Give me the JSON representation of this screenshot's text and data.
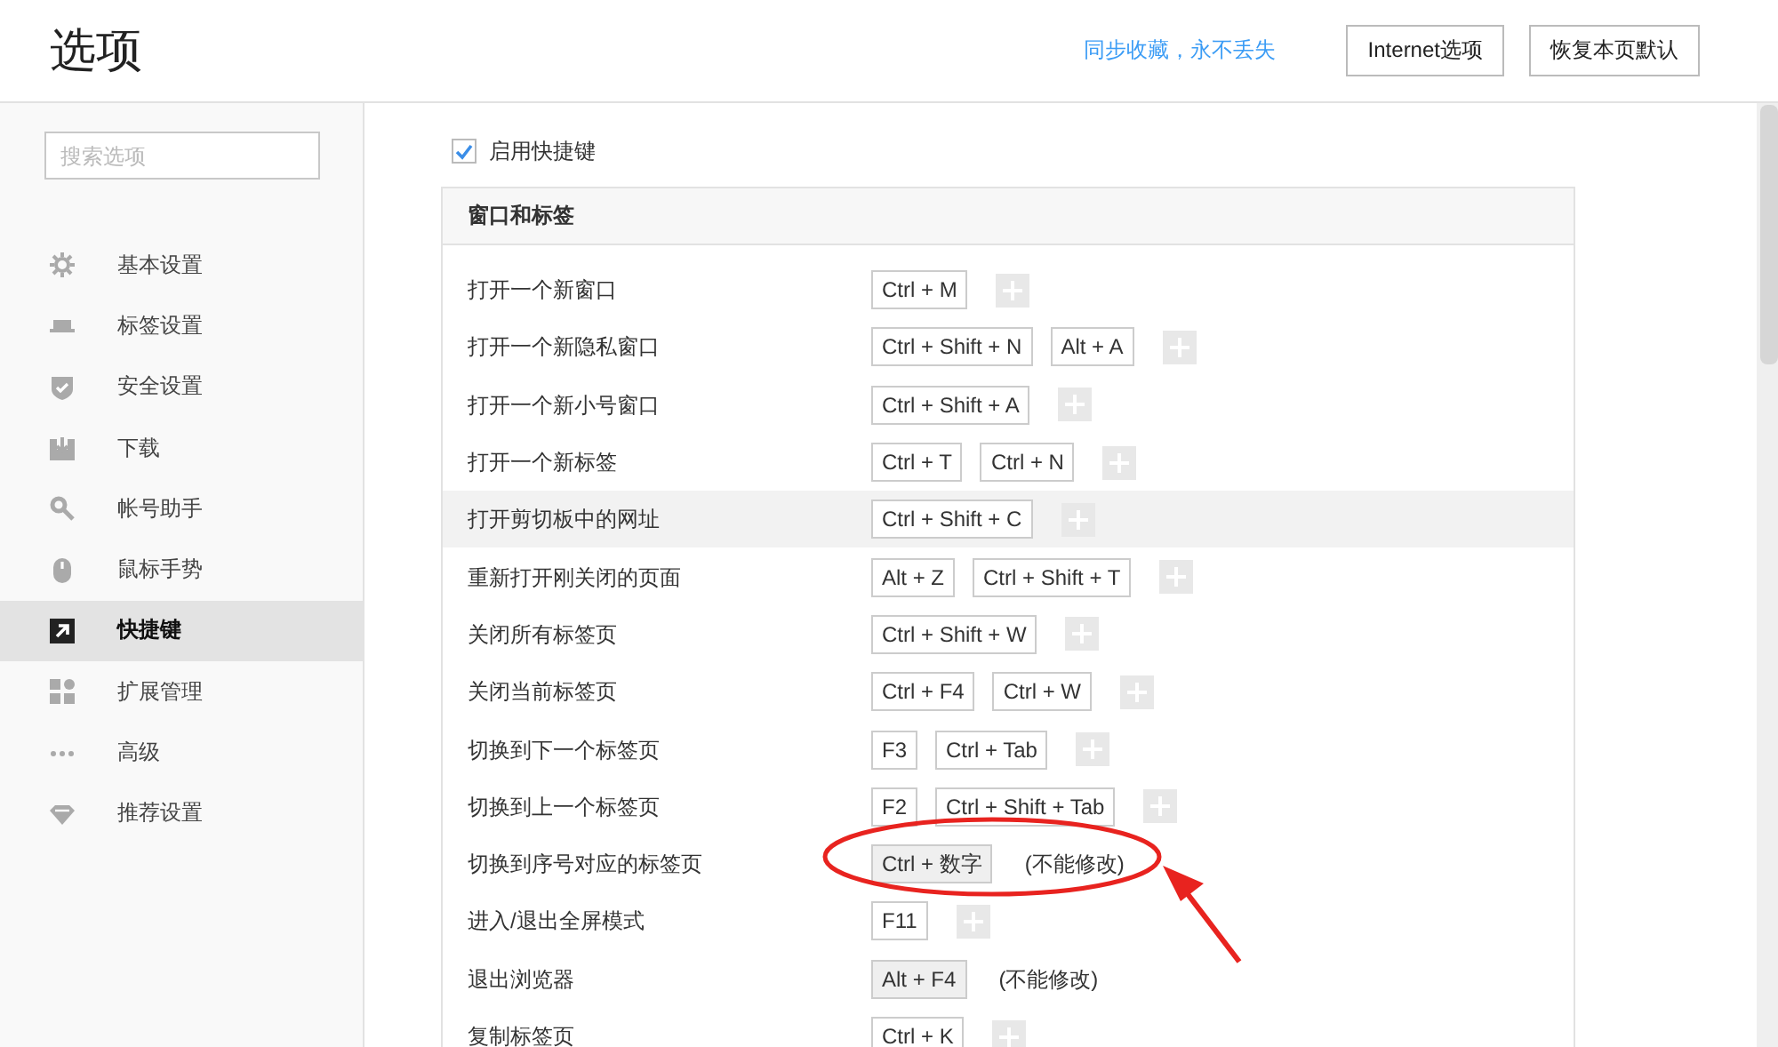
{
  "window": {
    "title": "选项"
  },
  "header": {
    "sync_link": "同步收藏，永不丢失",
    "buttons": [
      "Internet选项",
      "恢复本页默认"
    ]
  },
  "sidebar": {
    "search": {
      "placeholder": "搜索选项"
    },
    "items": [
      {
        "label": "基本设置",
        "selected": false
      },
      {
        "label": "标签设置",
        "selected": false
      },
      {
        "label": "安全设置",
        "selected": false
      },
      {
        "label": "下载",
        "selected": false
      },
      {
        "label": "帐号助手",
        "selected": false
      },
      {
        "label": "鼠标手势",
        "selected": false
      },
      {
        "label": "快捷键",
        "selected": true
      },
      {
        "label": "扩展管理",
        "selected": false
      },
      {
        "label": "高级",
        "selected": false
      },
      {
        "label": "推荐设置",
        "selected": false
      }
    ]
  },
  "enable_shortcuts": {
    "label": "启用快捷键",
    "checked": true
  },
  "section": {
    "title": "窗口和标签",
    "rows": [
      {
        "label": "打开一个新窗口",
        "keys": [
          "Ctrl + M"
        ],
        "fixed": false,
        "highlighted": false
      },
      {
        "label": "打开一个新隐私窗口",
        "keys": [
          "Ctrl + Shift + N",
          "Alt + A"
        ],
        "fixed": false,
        "highlighted": false
      },
      {
        "label": "打开一个新小号窗口",
        "keys": [
          "Ctrl + Shift + A"
        ],
        "fixed": false,
        "highlighted": false
      },
      {
        "label": "打开一个新标签",
        "keys": [
          "Ctrl + T",
          "Ctrl + N"
        ],
        "fixed": false,
        "highlighted": false
      },
      {
        "label": "打开剪切板中的网址",
        "keys": [
          "Ctrl + Shift + C"
        ],
        "fixed": false,
        "highlighted": true
      },
      {
        "label": "重新打开刚关闭的页面",
        "keys": [
          "Alt + Z",
          "Ctrl + Shift + T"
        ],
        "fixed": false,
        "highlighted": false
      },
      {
        "label": "关闭所有标签页",
        "keys": [
          "Ctrl + Shift + W"
        ],
        "fixed": false,
        "highlighted": false
      },
      {
        "label": "关闭当前标签页",
        "keys": [
          "Ctrl + F4",
          "Ctrl + W"
        ],
        "fixed": false,
        "highlighted": false
      },
      {
        "label": "切换到下一个标签页",
        "keys": [
          "F3",
          "Ctrl + Tab"
        ],
        "fixed": false,
        "highlighted": false
      },
      {
        "label": "切换到上一个标签页",
        "keys": [
          "F2",
          "Ctrl + Shift + Tab"
        ],
        "fixed": false,
        "highlighted": false
      },
      {
        "label": "切换到序号对应的标签页",
        "keys": [
          "Ctrl + 数字"
        ],
        "fixed": true,
        "note": "(不能修改)",
        "highlighted": false
      },
      {
        "label": "进入/退出全屏模式",
        "keys": [
          "F11"
        ],
        "fixed": false,
        "highlighted": false
      },
      {
        "label": "退出浏览器",
        "keys": [
          "Alt + F4"
        ],
        "fixed": true,
        "note": "(不能修改)",
        "highlighted": false
      },
      {
        "label": "复制标签页",
        "keys": [
          "Ctrl + K"
        ],
        "fixed": false,
        "highlighted": false
      }
    ]
  },
  "annotations": [
    {
      "kind": "ellipse"
    },
    {
      "kind": "arrow"
    }
  ]
}
